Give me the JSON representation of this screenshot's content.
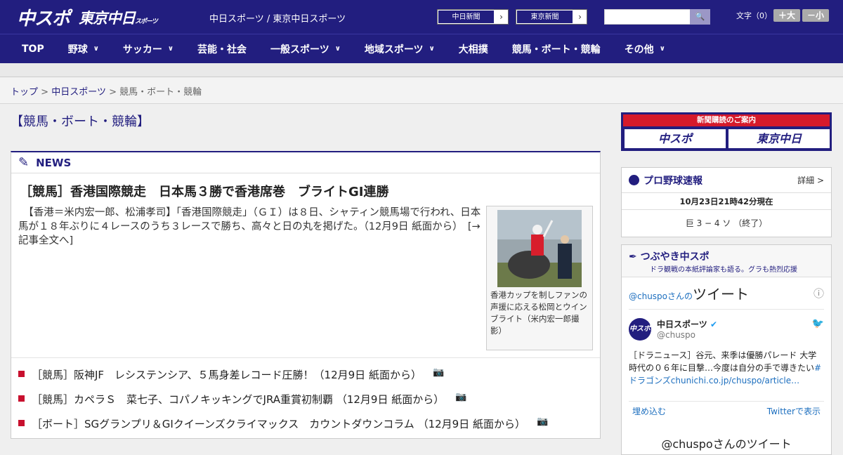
{
  "header": {
    "logo_main": "中スポ",
    "logo_tokyo": "東京中日",
    "logo_tokyo_small": "スポーツ",
    "title": "中日スポーツ / 東京中日スポーツ",
    "paper_buttons": [
      {
        "label": "中日新聞"
      },
      {
        "label": "東京新聞"
      }
    ],
    "search_placeholder": "",
    "fontsize_label": "文字（0）",
    "fontsize_up": "＋大",
    "fontsize_down": "－小"
  },
  "nav": {
    "items": [
      {
        "label": "TOP",
        "dropdown": false
      },
      {
        "label": "野球",
        "dropdown": true
      },
      {
        "label": "サッカー",
        "dropdown": true
      },
      {
        "label": "芸能・社会",
        "dropdown": false
      },
      {
        "label": "一般スポーツ",
        "dropdown": true
      },
      {
        "label": "地域スポーツ",
        "dropdown": true
      },
      {
        "label": "大相撲",
        "dropdown": false
      },
      {
        "label": "競馬・ボート・競輪",
        "dropdown": false
      },
      {
        "label": "その他",
        "dropdown": true
      }
    ]
  },
  "breadcrumb": {
    "items": [
      "トップ",
      "中日スポーツ",
      "競馬・ボート・競輪"
    ],
    "separator": ">"
  },
  "main": {
    "section_title": "【競馬・ボート・競輪】",
    "news_label": "NEWS",
    "lead": {
      "title": "［競馬］香港国際競走　日本馬３勝で香港席巻　ブライトGI連勝",
      "body": "　【香港＝米内宏一郎、松浦孝司】「香港国際競走」（ＧＩ）は８日、シャティン競馬場で行われ、日本馬が１８年ぶりに４レースのうち３レースで勝ち、高々と日の丸を掲げた。（12月9日 紙面から）　[→記事全文へ]",
      "photo_caption": "香港カップを制しファンの声援に応える松岡とウインブライト（米内宏一郎撮影）"
    },
    "news_items": [
      {
        "text": "［競馬］阪神JF　レシステンシア、５馬身差レコード圧勝！（12月9日 紙面から）"
      },
      {
        "text": "［競馬］カペラＳ　菜七子、コパノキッキングでJRA重賞初制覇 （12月9日 紙面から）"
      },
      {
        "text": "［ボート］SGグランプリ＆GIクイーンズクライマックス　カウントダウンコラム （12月9日 紙面から）"
      }
    ]
  },
  "sidebar": {
    "ad": {
      "top": "新聞購読のご案内",
      "logo_left": "中スポ",
      "logo_right": "東京中日"
    },
    "baseball": {
      "title": "プロ野球速報",
      "more": "詳細 >",
      "time": "10月23日21時42分現在",
      "score": "巨 3 − 4 ソ （終了）"
    },
    "twitter": {
      "title": "つぶやき中スポ",
      "subtitle": "ドラ観戦の本紙評論家も語る。グラも熱烈応援",
      "handle_prefix": "@chuspoさんの",
      "handle_big": "ツイート",
      "user_name": "中日スポーツ",
      "user_handle": "@chuspo",
      "avatar_text": "中スポ",
      "tweet_text": "［ドラニュース］谷元、来季は優勝パレード 大学時代の０６年に目撃…今度は自分の手で導きたい",
      "tweet_link": "#ドラゴンズchunichi.co.jp/chuspo/article…",
      "embed": "埋め込む",
      "view_on_twitter": "Twitterで表示",
      "more_title": "@chuspoさんのツイート"
    }
  },
  "colors": {
    "brand_navy": "#221e7f",
    "accent_red": "#c8102e",
    "link_blue": "#1d6fbf"
  },
  "icons": {
    "news": "pencil-icon",
    "baseball": "ball-icon",
    "twitter": "bird-icon",
    "camera": "camera-icon",
    "search": "search-icon"
  }
}
